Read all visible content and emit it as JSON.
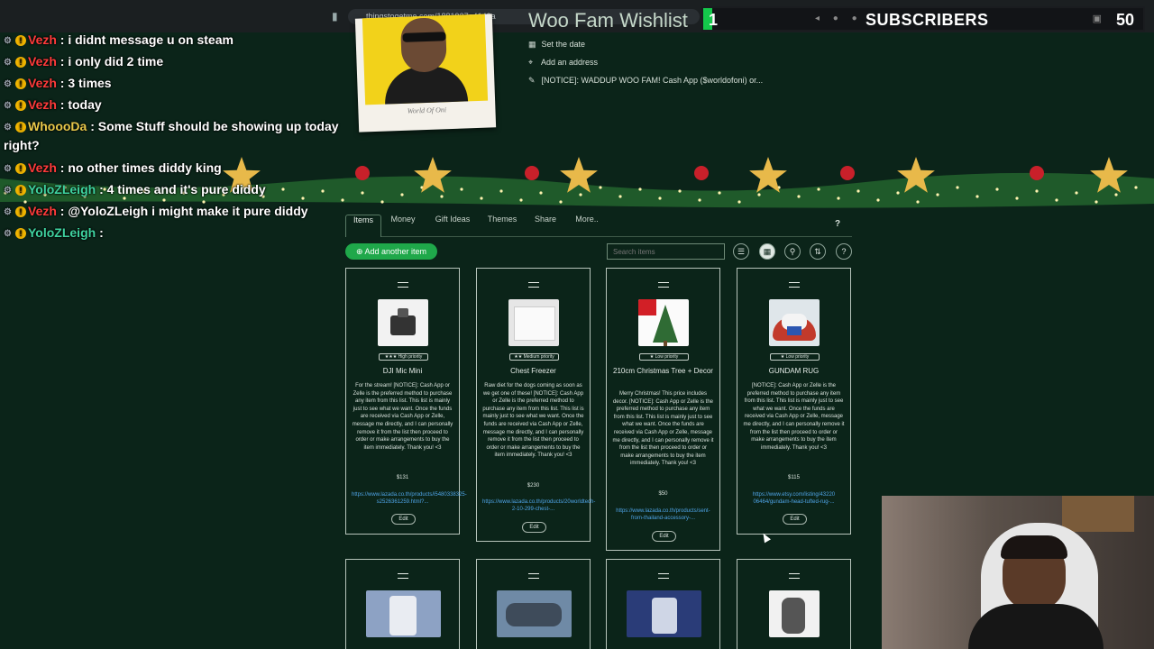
{
  "browser": {
    "url": "thingstogetme.com/1881937a4149a",
    "subs_count": "1",
    "subs_label": "SUBSCRIBERS",
    "subs_goal": "50"
  },
  "wishlist": {
    "title": "Woo Fam Wishlist",
    "set_date": "Set the date",
    "add_address": "Add an address",
    "notice": "[NOTICE]: WADDUP WOO FAM! Cash App ($worldofoni) or...",
    "poster_caption": "World Of Oni"
  },
  "tabs": [
    "Items",
    "Money",
    "Gift Ideas",
    "Themes",
    "Share",
    "More.."
  ],
  "tabs_help": "?",
  "toolbar": {
    "add_item": "Add another item",
    "search_placeholder": "Search items",
    "help": "?"
  },
  "items": [
    {
      "priority_stars": "★★★",
      "priority": "High priority",
      "title": "DJI Mic Mini",
      "description": "For the stream! [NOTICE]: Cash App or Zelle is the preferred method to purchase any item from this list. This list is mainly just to see what we want. Once the funds are received via Cash App or Zelle, message me directly, and I can personally remove it from the list then proceed to order or make arrangements to buy the item immediately. Thank you! <3",
      "price": "$131",
      "link": "https://www.lazada.co.th/products/i5480338325-s2526361259.html?...",
      "edit": "Edit"
    },
    {
      "priority_stars": "★★",
      "priority": "Medium priority",
      "title": "Chest Freezer",
      "description": "Raw diet for the dogs coming as soon as we get one of these! [NOTICE]: Cash App or Zelle is the preferred method to purchase any item from this list. This list is mainly just to see what we want. Once the funds are received via Cash App or Zelle, message me directly, and I can personally remove it from the list then proceed to order or make arrangements to buy the item immediately. Thank you! <3",
      "price": "$230",
      "link": "https://www.lazada.co.th/products/20worldtech-2-10-299-chest-...",
      "edit": "Edit"
    },
    {
      "priority_stars": "★",
      "priority": "Low priority",
      "title": "210cm Christmas Tree + Decor",
      "description": "Merry Christmas! This price includes decor. [NOTICE]: Cash App or Zelle is the preferred method to purchase any item from this list. This list is mainly just to see what we want. Once the funds are received via Cash App or Zelle, message me directly, and I can personally remove it from the list then proceed to order or make arrangements to buy the item immediately. Thank you! <3",
      "price": "$50",
      "link": "https://www.lazada.co.th/products/sent-from-thailand-accessory-...",
      "edit": "Edit"
    },
    {
      "priority_stars": "★",
      "priority": "Low priority",
      "title": "GUNDAM RUG",
      "description": "[NOTICE]: Cash App or Zelle is the preferred method to purchase any item from this list. This list is mainly just to see what we want. Once the funds are received via Cash App or Zelle, message me directly, and I can personally remove it from the list then proceed to order or make arrangements to buy the item immediately. Thank you! <3",
      "price": "$115",
      "link": "https://www.etsy.com/listing/43220 06464/gundam-head-tufted-rug-...",
      "edit": "Edit"
    }
  ],
  "chat": [
    {
      "user": "Vezh",
      "color": "#ff3b3b",
      "text": ": i didnt message u on steam"
    },
    {
      "user": "Vezh",
      "color": "#ff3b3b",
      "text": ": i only did 2 time"
    },
    {
      "user": "Vezh",
      "color": "#ff3b3b",
      "text": ": 3 times"
    },
    {
      "user": "Vezh",
      "color": "#ff3b3b",
      "text": ": today"
    },
    {
      "user": "WhoooDa",
      "color": "#e8c84a",
      "text": ": Some Stuff should be showing up today"
    },
    {
      "user": "",
      "color": "#ffffff",
      "text": "right?"
    },
    {
      "user": "Vezh",
      "color": "#ff3b3b",
      "text": ": no other times diddy king"
    },
    {
      "user": "YoloZLeigh",
      "color": "#3fd3a0",
      "text": ": 4 times and it's pure diddy"
    },
    {
      "user": "Vezh",
      "color": "#ff3b3b",
      "text": ": @YoloZLeigh i might make it pure diddy"
    },
    {
      "user": "YoloZLeigh",
      "color": "#3fd3a0",
      "text": ":"
    }
  ],
  "colors": {
    "page_bg": "#0b2419",
    "accent_green": "#1fa84a",
    "link_blue": "#4fa4e8"
  }
}
